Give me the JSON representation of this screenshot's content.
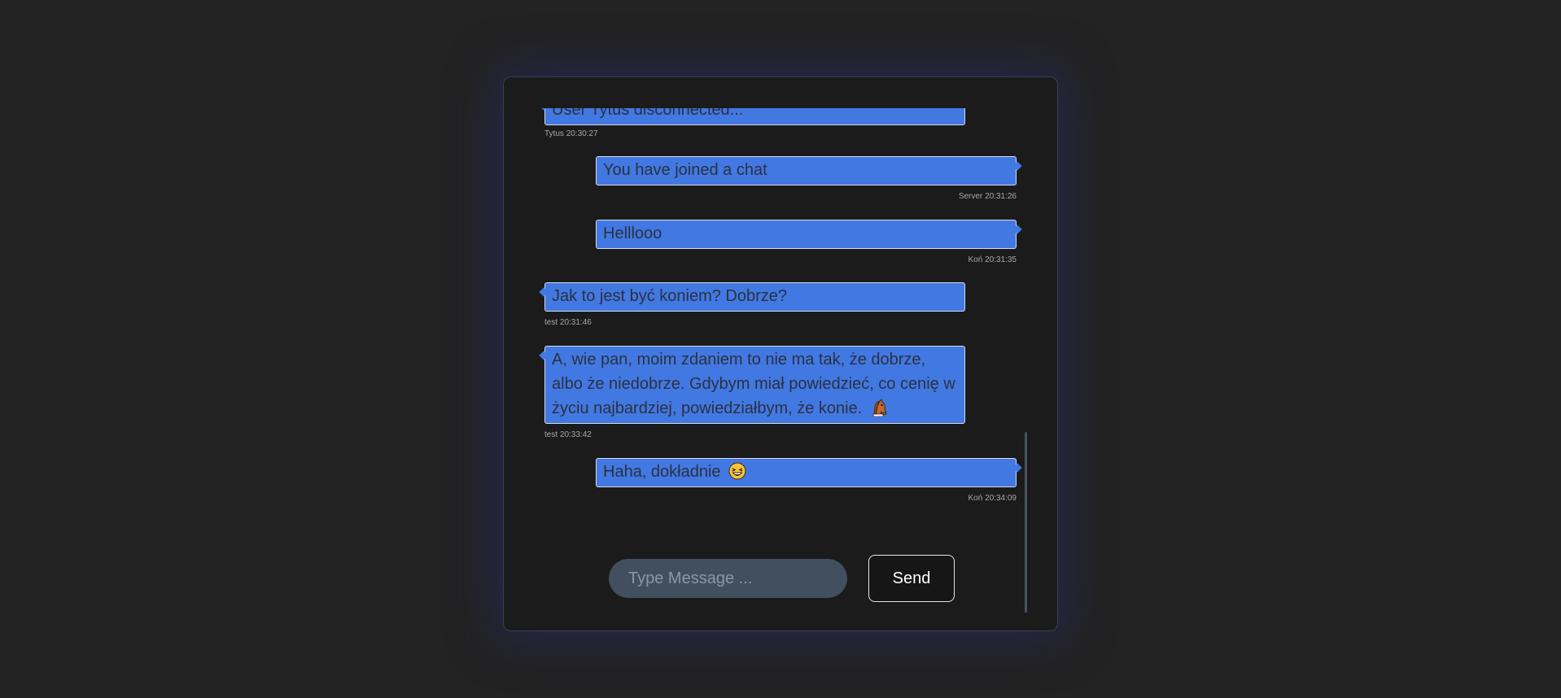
{
  "messages": [
    {
      "side": "left",
      "text": "User Tytus disconnected...",
      "author": "Tytus",
      "time": "20:30:27"
    },
    {
      "side": "right",
      "text": "You have joined a chat",
      "author": "Server",
      "time": "20:31:26"
    },
    {
      "side": "right",
      "text": "Helllooo",
      "author": "Koń",
      "time": "20:31:35"
    },
    {
      "side": "left",
      "text": "Jak to jest być koniem? Dobrze?",
      "author": "test",
      "time": "20:31:46"
    },
    {
      "side": "left",
      "text": "A, wie pan, moim zdaniem to nie ma tak, że dobrze, albo że niedobrze. Gdybym miał powiedzieć, co cenię w życiu najbardziej, powiedziałbym, że konie.",
      "emoji": "horse-face-emoji",
      "author": "test",
      "time": "20:33:42"
    },
    {
      "side": "right",
      "text": "Haha, dokładnie",
      "emoji": "laughing-face-emoji",
      "author": "Koń",
      "time": "20:34:09"
    }
  ],
  "composer": {
    "placeholder": "Type Message ...",
    "value": "",
    "send_label": "Send"
  },
  "colors": {
    "page_bg": "#232323",
    "card_bg": "#1b1b1b",
    "bubble_bg": "#4278e2",
    "bubble_text": "#2b3140",
    "input_bg": "#424f5e"
  }
}
